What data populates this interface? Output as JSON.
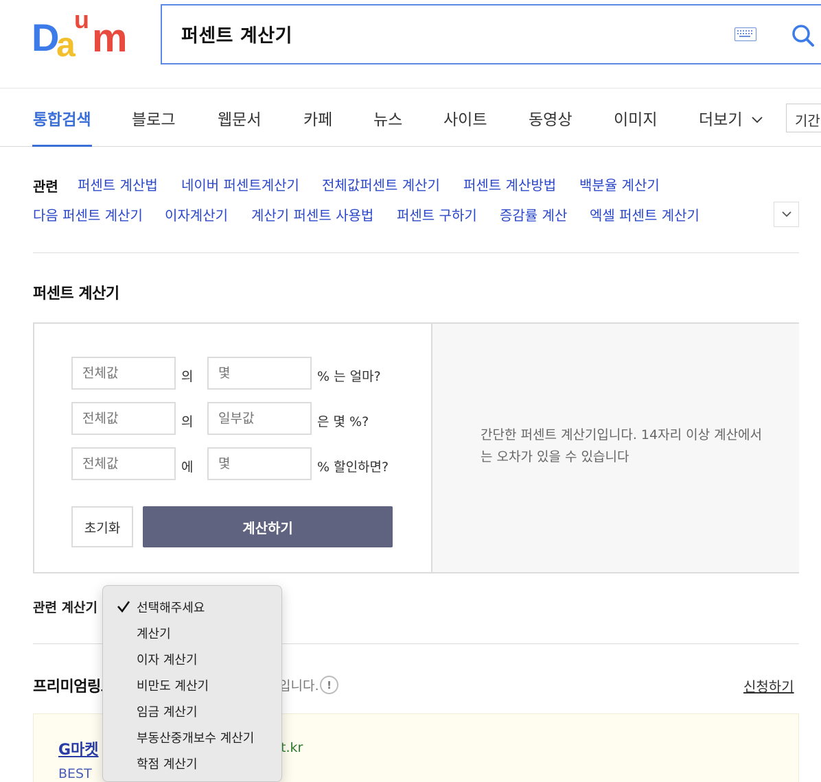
{
  "logo": {
    "letters": [
      "D",
      "a",
      "u",
      "m"
    ],
    "colors": [
      "#3d7be8",
      "#f2c02d",
      "#e84a3d",
      "#e84a3d",
      "#39b54a"
    ]
  },
  "search": {
    "query": "퍼센트 계산기"
  },
  "tabs": [
    {
      "label": "통합검색",
      "active": true
    },
    {
      "label": "블로그"
    },
    {
      "label": "웹문서"
    },
    {
      "label": "카페"
    },
    {
      "label": "뉴스"
    },
    {
      "label": "사이트"
    },
    {
      "label": "동영상"
    },
    {
      "label": "이미지"
    },
    {
      "label": "더보기"
    }
  ],
  "period_label": "기간",
  "related": {
    "title": "관련",
    "links": [
      "퍼센트 계산법",
      "네이버 퍼센트계산기",
      "전체값퍼센트 계산기",
      "퍼센트 계산방법",
      "백분율 계산기",
      "다음 퍼센트 계산기",
      "이자계산기",
      "계산기 퍼센트 사용법",
      "퍼센트 구하기",
      "증감률 계산",
      "엑셀 퍼센트 계산기"
    ]
  },
  "calculator": {
    "title": "퍼센트 계산기",
    "rows": [
      {
        "placeholder1": "전체값",
        "joiner": "의",
        "placeholder2": "몇",
        "suffix": "% 는 얼마?"
      },
      {
        "placeholder1": "전체값",
        "joiner": "의",
        "placeholder2": "일부값",
        "suffix": "은 몇 %?"
      },
      {
        "placeholder1": "전체값",
        "joiner": "에",
        "placeholder2": "몇",
        "suffix": "% 할인하면?"
      }
    ],
    "reset_label": "초기화",
    "calc_label": "계산하기",
    "description": "간단한 퍼센트 계산기입니다. 14자리 이상 계산에서는 오차가 있을 수 있습니다"
  },
  "related_calc": {
    "label": "관련 계산기",
    "options": [
      "선택해주세요",
      "계산기",
      "이자 계산기",
      "비만도 계산기",
      "임금 계산기",
      "부동산중개보수 계산기",
      "학점 계산기"
    ],
    "selected_index": 0
  },
  "premium": {
    "title": "프리미엄링크",
    "suffix": "입니다.",
    "apply_label": "신청하기",
    "ad_title": "G마켓",
    "ad_url": "t.kr",
    "ad_sub": "BEST"
  }
}
